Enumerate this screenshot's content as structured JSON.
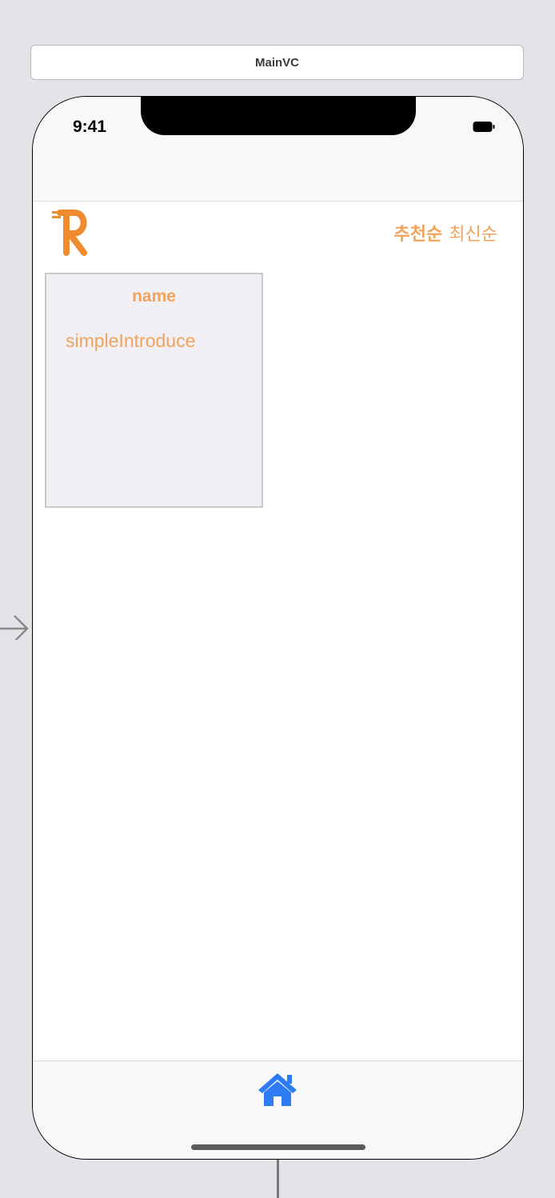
{
  "scene": {
    "title": "MainVC"
  },
  "status_bar": {
    "time": "9:41",
    "battery_icon": "battery-icon"
  },
  "header": {
    "logo_icon": "r-logo-icon",
    "sort": {
      "recommended_label": "추천순",
      "newest_label": "최신순"
    }
  },
  "cards": [
    {
      "name": "name",
      "intro": "simpleIntroduce"
    }
  ],
  "tab_bar": {
    "items": [
      {
        "icon": "home-icon",
        "color": "#2d7cf6",
        "selected": true
      }
    ]
  },
  "colors": {
    "accent": "#f2a35c",
    "tab_selected": "#2d7cf6",
    "canvas": "#e3e4e8",
    "card_background": "#efeff4"
  }
}
